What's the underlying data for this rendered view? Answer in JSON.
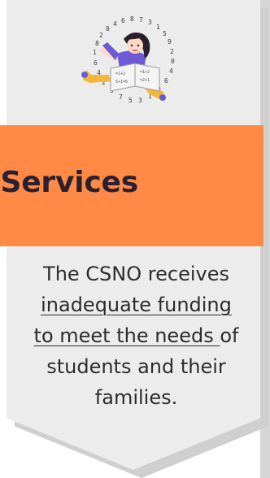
{
  "card": {
    "title": "l Services",
    "illustration": "student-with-numbers-illustration",
    "body": {
      "before": "The CSNO receives ",
      "underlined": "inadequate funding to meet the needs ",
      "after": "of students and their families."
    }
  },
  "colors": {
    "accent": "#ff8a46",
    "card_bg": "#ececec",
    "title_text": "#2a2130",
    "body_text": "#2c2c2c"
  }
}
